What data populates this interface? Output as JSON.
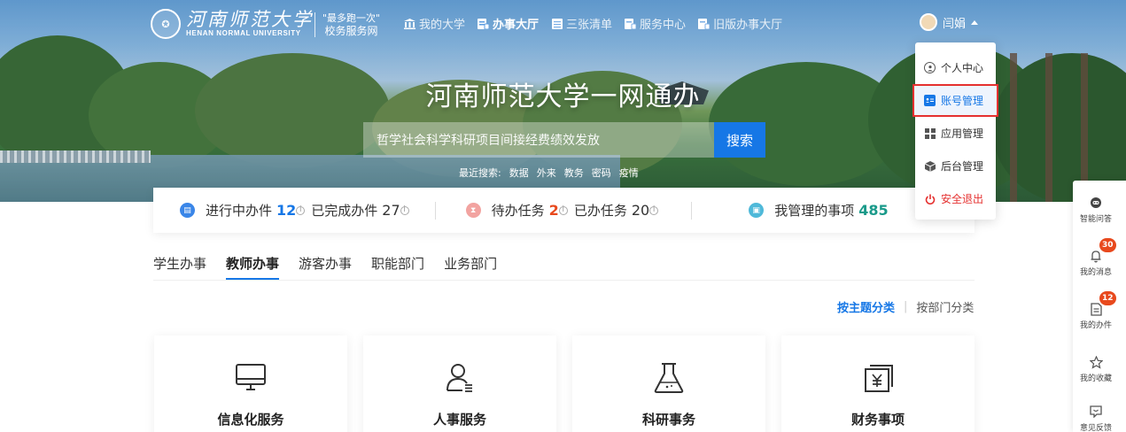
{
  "header": {
    "logo_cn": "河南师范大学",
    "logo_en": "HENAN NORMAL UNIVERSITY",
    "slogan_line1": "\"最多跑一次\"",
    "slogan_line2": "校务服务网",
    "nav": [
      {
        "label": "我的大学",
        "icon": "building-icon",
        "active": false
      },
      {
        "label": "办事大厅",
        "icon": "hall-icon",
        "active": true
      },
      {
        "label": "三张清单",
        "icon": "list-icon",
        "active": false
      },
      {
        "label": "服务中心",
        "icon": "service-icon",
        "active": false
      },
      {
        "label": "旧版办事大厅",
        "icon": "old-hall-icon",
        "active": false
      }
    ],
    "user_name": "闫娟"
  },
  "user_menu": {
    "items": [
      {
        "label": "个人中心",
        "icon": "user-circle-icon"
      },
      {
        "label": "账号管理",
        "icon": "id-card-icon"
      },
      {
        "label": "应用管理",
        "icon": "apps-grid-icon"
      },
      {
        "label": "后台管理",
        "icon": "cube-icon"
      },
      {
        "label": "安全退出",
        "icon": "power-icon"
      }
    ]
  },
  "hero": {
    "title": "河南师范大学一网通办",
    "search_placeholder": "哲学社会科学科研项目间接经费绩效发放",
    "search_button": "搜索",
    "recent_label": "最近搜索:",
    "recent": [
      "数据",
      "外来",
      "教务",
      "密码",
      "疫情"
    ]
  },
  "stats": {
    "in_progress_label": "进行中办件",
    "in_progress_value": "12",
    "completed_label": "已完成办件",
    "completed_value": "27",
    "pending_label": "待办任务",
    "pending_value": "2",
    "done_label": "已办任务",
    "done_value": "20",
    "managed_label": "我管理的事项",
    "managed_value": "485",
    "info_mark": "i"
  },
  "tabs": [
    "学生办事",
    "教师办事",
    "游客办事",
    "职能部门",
    "业务部门"
  ],
  "active_tab": 1,
  "sort": {
    "by_topic": "按主题分类",
    "separator": "|",
    "by_department": "按部门分类"
  },
  "cards": [
    {
      "title": "信息化服务",
      "icon": "monitor-icon"
    },
    {
      "title": "人事服务",
      "icon": "person-icon"
    },
    {
      "title": "科研事务",
      "icon": "flask-icon"
    },
    {
      "title": "财务事项",
      "icon": "yuan-bill-icon"
    }
  ],
  "sidebar": {
    "items": [
      {
        "label": "智能问答",
        "icon": "robot-icon",
        "badge": ""
      },
      {
        "label": "我的消息",
        "icon": "bell-icon",
        "badge": "30"
      },
      {
        "label": "我的办件",
        "icon": "document-icon",
        "badge": "12"
      },
      {
        "label": "我的收藏",
        "icon": "star-icon",
        "badge": ""
      },
      {
        "label": "意见反馈",
        "icon": "feedback-icon",
        "badge": ""
      }
    ]
  },
  "colors": {
    "accent": "#1677e6",
    "danger": "#e5302f",
    "badge": "#e8491d",
    "stat_number_blue": "#1677e6",
    "stat_number_orange": "#e8491d",
    "stat_number_green": "#1a9a8a"
  }
}
